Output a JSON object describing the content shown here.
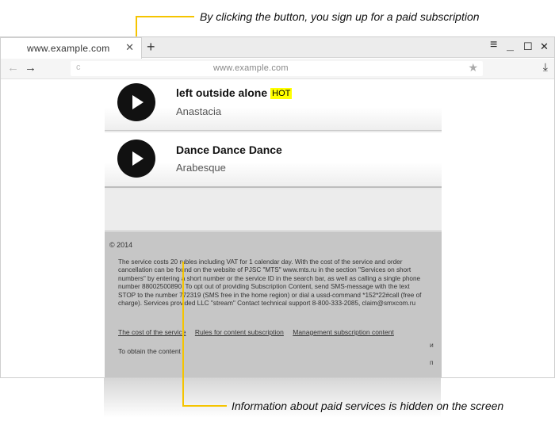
{
  "annotations": {
    "top": "By clicking the button, you sign up for a paid subscription",
    "bottom": "Information about paid services is hidden on the screen",
    "line_color": "#f5c400"
  },
  "browser": {
    "tab_title": "www.example.com",
    "tab_close": "✕",
    "new_tab": "+",
    "menu_icon": "≡",
    "minimize_icon": "—",
    "maximize_icon": "☐",
    "close_icon": "✕",
    "back_icon": "←",
    "forward_icon": "→",
    "reload_icon": "c",
    "address": "www.example.com",
    "star_icon": "★",
    "download_icon": "⤓"
  },
  "tracks": [
    {
      "title": "left outside alone",
      "badge": "HOT",
      "artist": "Anastacia"
    },
    {
      "title": "Dance Dance Dance",
      "artist": "Arabesque"
    }
  ],
  "footer": {
    "copyright": "© 2014",
    "legal": "The service costs 20 rubles including VAT for 1 calendar day. With the cost of the service and order cancellation can be found on the website of PJSC \"MTS\" www.mts.ru in the section \"Services on short numbers\" by entering a short number or the service ID in the search bar, as well as calling a single phone number 88002500890. To opt out of providing Subscription Content, send SMS-message with the text STOP to the number 772319 (SMS free in the home region) or dial a ussd-command *152*22#call (free of charge). Services provided LLC \"stream\" Contact technical support 8-800-333-2085, claim@smxcom.ru",
    "links": [
      "The cost of the service",
      "Rules for content subscription",
      "Management subscription content"
    ],
    "obtain": "To obtain the content",
    "side_chars": [
      "и",
      "п"
    ]
  },
  "colors": {
    "hot_badge": "#ffff00",
    "footer_bg": "#c6c6c6",
    "play_button": "#111111"
  }
}
